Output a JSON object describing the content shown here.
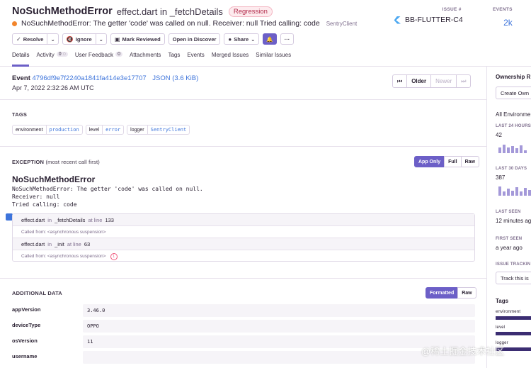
{
  "issue": {
    "error_type": "NoSuchMethodError",
    "culprit": "effect.dart in _fetchDetails",
    "badge": "Regression",
    "message": "NoSuchMethodError: The getter 'code' was called on null. Receiver: null Tried calling: code",
    "sdk": "SentryClient",
    "issue_label": "ISSUE #",
    "issue_id": "BB-FLUTTER-C4",
    "events_label": "EVENTS",
    "events_count": "2k"
  },
  "actions": {
    "resolve": "Resolve",
    "ignore": "Ignore",
    "mark_reviewed": "Mark Reviewed",
    "open_discover": "Open in Discover",
    "share": "Share",
    "more": "···"
  },
  "tabs": [
    {
      "label": "Details"
    },
    {
      "label": "Activity",
      "count": "0"
    },
    {
      "label": "User Feedback",
      "count": "0"
    },
    {
      "label": "Attachments"
    },
    {
      "label": "Tags"
    },
    {
      "label": "Events"
    },
    {
      "label": "Merged Issues"
    },
    {
      "label": "Similar Issues"
    }
  ],
  "event": {
    "label": "Event",
    "id": "4796df9e7f2240a1841fa414e3e17707",
    "json": "JSON (3.6 KiB)",
    "date": "Apr 7, 2022 2:32:26 AM UTC",
    "pager": {
      "first": "⏮",
      "older": "Older",
      "newer": "Newer",
      "last": "⏭"
    }
  },
  "tags_section": {
    "title": "TAGS",
    "items": [
      {
        "key": "environment",
        "value": "production"
      },
      {
        "key": "level",
        "value": "error"
      },
      {
        "key": "logger",
        "value": "SentryClient"
      }
    ]
  },
  "exception": {
    "title": "EXCEPTION",
    "subtitle": "(most recent call first)",
    "toggle": {
      "app_only": "App Only",
      "full": "Full",
      "raw": "Raw"
    },
    "type": "NoSuchMethodError",
    "value": "NoSuchMethodError: The getter 'code' was called on null.\nReceiver: null\nTried calling: code",
    "frames": [
      {
        "file": "effect.dart",
        "in": "in",
        "func": "_fetchDetails",
        "at": "at line",
        "line": "133",
        "called": "Called from: <asynchronous suspension>"
      },
      {
        "file": "effect.dart",
        "in": "in",
        "func": "_init",
        "at": "at line",
        "line": "63",
        "called": "Called from: <asynchronous suspension>",
        "extra": "1"
      }
    ]
  },
  "additional": {
    "title": "ADDITIONAL DATA",
    "toggle": {
      "formatted": "Formatted",
      "raw": "Raw"
    },
    "rows": [
      {
        "key": "appVersion",
        "value": "3.46.0"
      },
      {
        "key": "deviceType",
        "value": "OPPO"
      },
      {
        "key": "osVersion",
        "value": "11"
      },
      {
        "key": "username",
        "value": ""
      }
    ]
  },
  "sidebar": {
    "ownership": "Ownership R",
    "create_owner": "Create Own",
    "all_env": "All Environme",
    "last24_label": "LAST 24 HOURS",
    "last24_val": "42",
    "last24_bars": [
      0.55,
      0.85,
      0.6,
      0.7,
      0.5,
      0.8,
      0.3
    ],
    "last30_label": "LAST 30 DAYS",
    "last30_val": "387",
    "last30_bars": [
      0.9,
      0.45,
      0.7,
      0.5,
      0.85,
      0.4,
      0.75,
      0.6,
      0.8,
      0.95
    ],
    "last_seen_label": "LAST SEEN",
    "last_seen_val": "12 minutes ag",
    "first_seen_label": "FIRST SEEN",
    "first_seen_val": "a year ago",
    "tracking_label": "ISSUE TRACKIN",
    "tracking_val": "Track this is",
    "tags_title": "Tags",
    "tag_env": "environment",
    "tag_level": "level",
    "tag_logger": "logger"
  },
  "watermark": "@稀土掘金技术社区"
}
